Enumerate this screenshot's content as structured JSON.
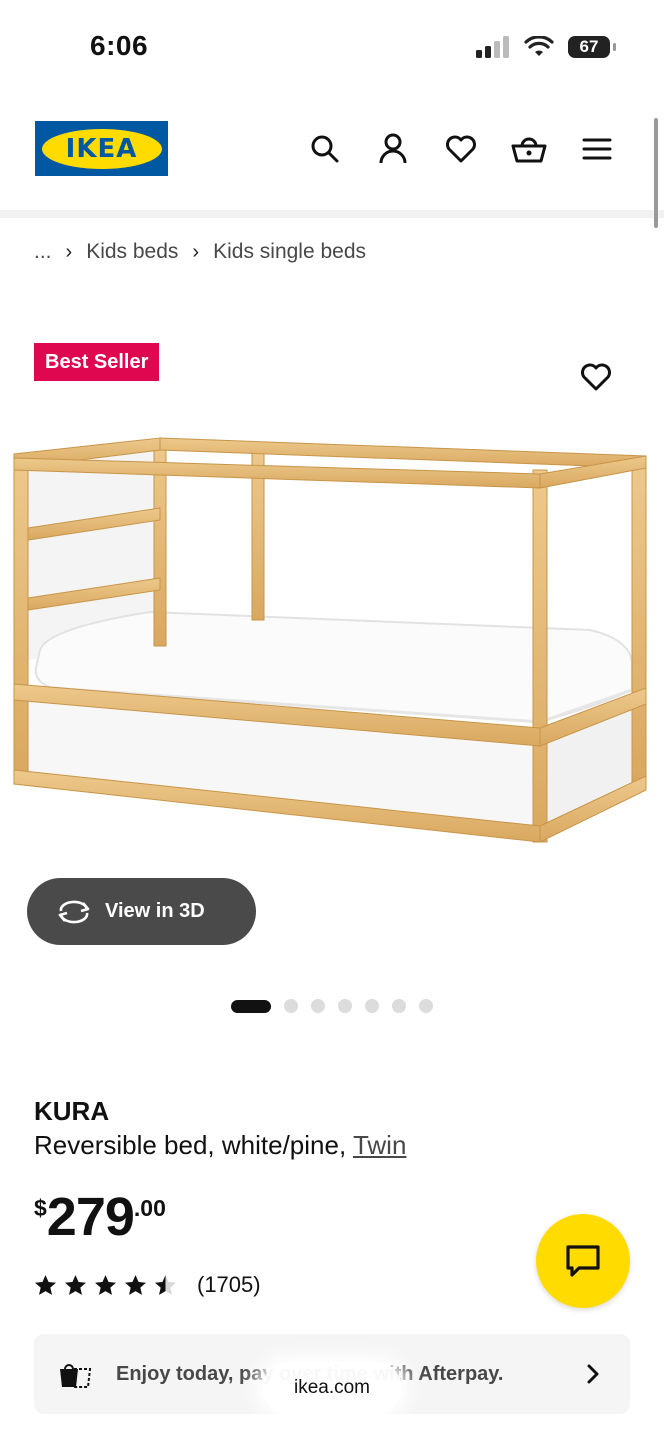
{
  "status": {
    "time": "6:06",
    "battery": "67"
  },
  "header": {
    "logo": "IKEA"
  },
  "breadcrumb": {
    "ellipsis": "...",
    "items": [
      "Kids beds",
      "Kids single beds"
    ]
  },
  "badge": "Best Seller",
  "view3d": "View in 3D",
  "carousel": {
    "count": 7,
    "active": 0
  },
  "product": {
    "name": "KURA",
    "desc": "Reversible bed, white/pine, ",
    "size": "Twin",
    "price_currency": "$",
    "price_main": "279",
    "price_cents": ".00",
    "rating": 4.5,
    "reviews": "(1705)"
  },
  "afterpay": "Enjoy today, pay over time with Afterpay.",
  "browser": {
    "url": "ikea.com"
  },
  "colors": {
    "ikea_blue": "#0058a3",
    "ikea_yellow": "#ffdb00",
    "badge_red": "#e00751"
  }
}
